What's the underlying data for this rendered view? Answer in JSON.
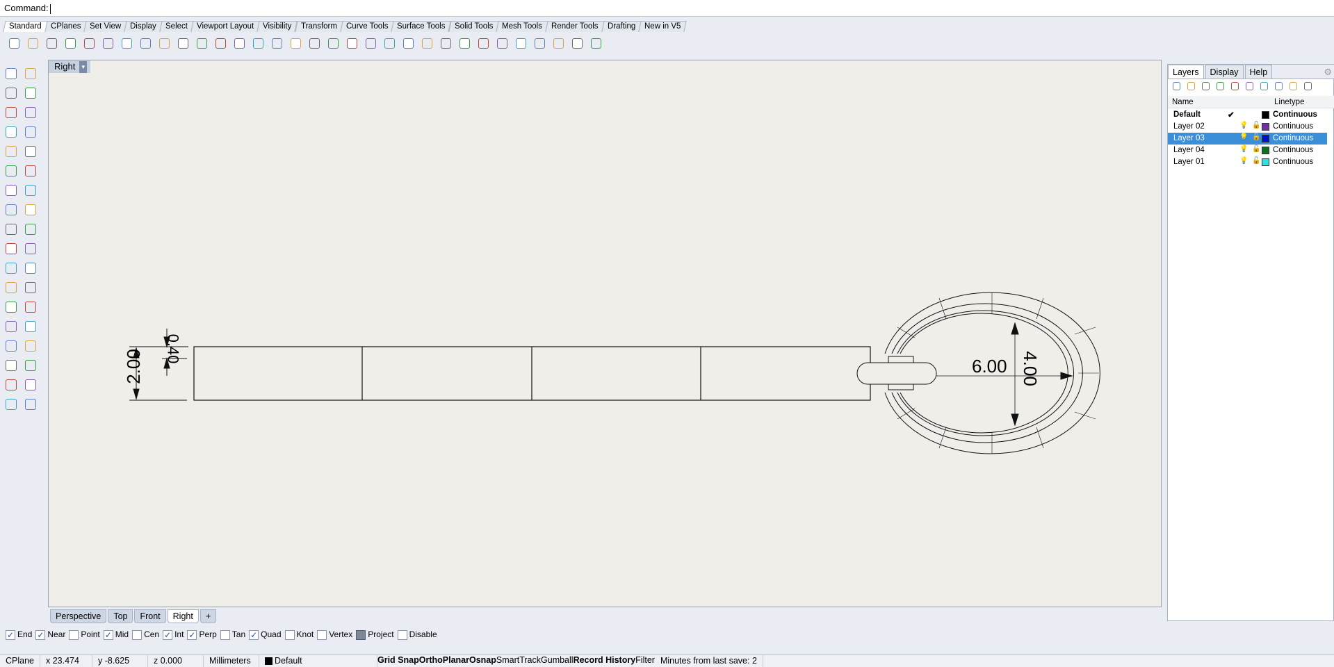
{
  "command": {
    "label": "Command:",
    "value": ""
  },
  "toolbar_tabs": [
    "Standard",
    "CPlanes",
    "Set View",
    "Display",
    "Select",
    "Viewport Layout",
    "Visibility",
    "Transform",
    "Curve Tools",
    "Surface Tools",
    "Solid Tools",
    "Mesh Tools",
    "Render Tools",
    "Drafting",
    "New in V5"
  ],
  "active_toolbar_tab": "Standard",
  "toolbar_icons": [
    "new-file",
    "open-folder",
    "save",
    "print",
    "import",
    "cut",
    "copy",
    "paste",
    "undo",
    "pan-hand",
    "rotate-view",
    "zoom",
    "zoom-window",
    "zoom-extents",
    "zoom-selected",
    "undo-view",
    "four-viewports",
    "car-render",
    "properties",
    "cplane",
    "hide-objects",
    "light-bulb",
    "lock",
    "layer-stack",
    "color-wheel",
    "shaded-sphere",
    "rendered-sphere",
    "render-sphere",
    "cursor-tool",
    "gear-settings",
    "dimension",
    "help"
  ],
  "left_icons": [
    "select-arrow",
    "point",
    "polyline",
    "line",
    "circle",
    "ellipse",
    "curve",
    "rectangle",
    "circle-center",
    "arc",
    "surface",
    "revolve",
    "box",
    "sphere",
    "cylinder",
    "extrude",
    "gears",
    "explode",
    "trim",
    "split",
    "boolean",
    "blend",
    "fillet",
    "rebuild",
    "text",
    "scale",
    "array",
    "offset",
    "solid-box",
    "analyze",
    "grid",
    "move",
    "cage-edit",
    "check",
    "box-edit",
    "sweep"
  ],
  "viewport": {
    "title": "Right",
    "dimensions": {
      "height": "2.00",
      "offset": "0.40",
      "ring_width": "6.00",
      "ring_height": "4.00"
    }
  },
  "viewport_tabs": [
    "Perspective",
    "Top",
    "Front",
    "Right"
  ],
  "active_viewport_tab": "Right",
  "osnap": [
    {
      "label": "End",
      "checked": true
    },
    {
      "label": "Near",
      "checked": true
    },
    {
      "label": "Point",
      "checked": false
    },
    {
      "label": "Mid",
      "checked": true
    },
    {
      "label": "Cen",
      "checked": false
    },
    {
      "label": "Int",
      "checked": true
    },
    {
      "label": "Perp",
      "checked": true
    },
    {
      "label": "Tan",
      "checked": false
    },
    {
      "label": "Quad",
      "checked": true
    },
    {
      "label": "Knot",
      "checked": false
    },
    {
      "label": "Vertex",
      "checked": false
    },
    {
      "label": "Project",
      "checked": "partial"
    },
    {
      "label": "Disable",
      "checked": false
    }
  ],
  "status": {
    "cplane": "CPlane",
    "x": "x 23.474",
    "y": "y -8.625",
    "z": "z 0.000",
    "units": "Millimeters",
    "layer": "Default",
    "toggles": [
      {
        "label": "Grid Snap",
        "on": true
      },
      {
        "label": "Ortho",
        "on": true
      },
      {
        "label": "Planar",
        "on": true
      },
      {
        "label": "Osnap",
        "on": true
      },
      {
        "label": "SmartTrack",
        "on": false
      },
      {
        "label": "Gumball",
        "on": false
      },
      {
        "label": "Record History",
        "on": true
      },
      {
        "label": "Filter",
        "on": false
      }
    ],
    "save_info": "Minutes from last save: 2"
  },
  "panel": {
    "tabs": [
      "Layers",
      "Display",
      "Help"
    ],
    "columns": {
      "name": "Name",
      "linetype": "Linetype"
    },
    "layers": [
      {
        "name": "Default",
        "color": "#000000",
        "linetype": "Continuous",
        "current": true
      },
      {
        "name": "Layer 02",
        "color": "#7030a0",
        "linetype": "Continuous"
      },
      {
        "name": "Layer 03",
        "color": "#0010c8",
        "linetype": "Continuous",
        "selected": true
      },
      {
        "name": "Layer 04",
        "color": "#107020",
        "linetype": "Continuous"
      },
      {
        "name": "Layer 01",
        "color": "#30e0e0",
        "linetype": "Continuous"
      }
    ],
    "tools": [
      "new-layer",
      "new-sublayer",
      "delete",
      "move-up",
      "move-down",
      "move-out",
      "filter",
      "tool-manage",
      "settings-hammer",
      "help"
    ],
    "check_mark": "✔"
  }
}
